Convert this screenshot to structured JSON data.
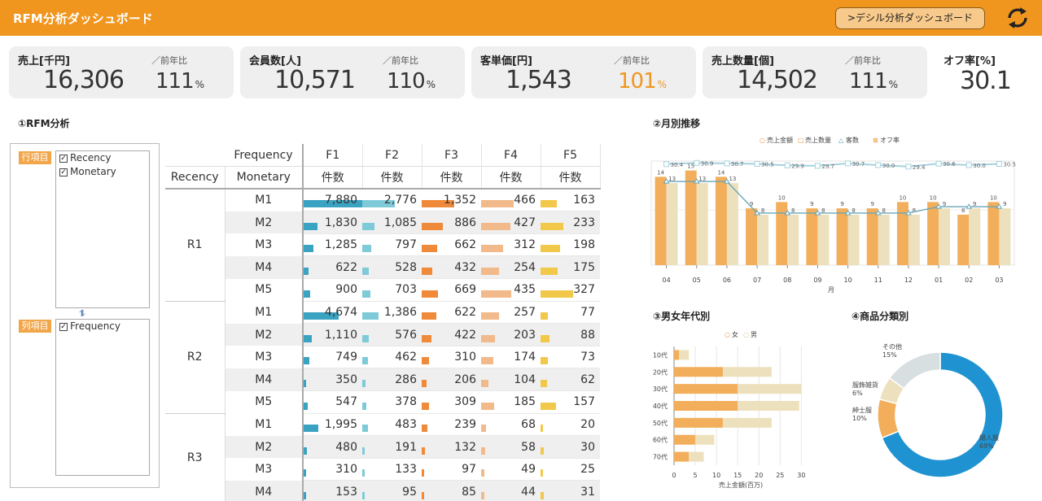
{
  "header": {
    "title": "RFM分析ダッシュボード",
    "button_label": ">デシル分析ダッシュボード",
    "refresh_icon": "refresh-icon",
    "color": "#f0961e"
  },
  "kpis": [
    {
      "label": "売上[千円]",
      "value": "16,306",
      "prev_label": "／前年比",
      "ratio": "111",
      "unit": "%",
      "ratio_color": "#333333"
    },
    {
      "label": "会員数[人]",
      "value": "10,571",
      "prev_label": "／前年比",
      "ratio": "110",
      "unit": "%",
      "ratio_color": "#333333"
    },
    {
      "label": "客単価[円]",
      "value": "1,543",
      "prev_label": "／前年比",
      "ratio": "101",
      "unit": "%",
      "ratio_color": "#f0961e"
    },
    {
      "label": "売上数量[個]",
      "value": "14,502",
      "prev_label": "／前年比",
      "ratio": "111",
      "unit": "%",
      "ratio_color": "#333333"
    },
    {
      "label": "オフ率[%]",
      "value": "30.1"
    }
  ],
  "rfm": {
    "title": "①RFM分析",
    "row_tag": "行項目",
    "col_tag": "列項目",
    "row_fields": [
      "Recency",
      "Monetary"
    ],
    "col_fields": [
      "Frequency"
    ],
    "swap_icon": "swap-icon",
    "header_row1": [
      "",
      "Frequency",
      "F1",
      "F2",
      "F3",
      "F4",
      "F5"
    ],
    "header_row2": [
      "Recency",
      "Monetary",
      "件数",
      "件数",
      "件数",
      "件数",
      "件数"
    ],
    "bar_colors": [
      "#3aa3c2",
      "#7fcad9",
      "#ef8a3a",
      "#f2b98a",
      "#f2c84a"
    ],
    "groups": [
      {
        "r": "R1",
        "rows": [
          {
            "m": "M1",
            "v": [
              7880,
              2776,
              1352,
              466,
              163
            ]
          },
          {
            "m": "M2",
            "v": [
              1830,
              1085,
              886,
              427,
              233
            ]
          },
          {
            "m": "M3",
            "v": [
              1285,
              797,
              662,
              312,
              198
            ]
          },
          {
            "m": "M4",
            "v": [
              622,
              528,
              432,
              254,
              175
            ]
          },
          {
            "m": "M5",
            "v": [
              900,
              703,
              669,
              435,
              327
            ]
          }
        ]
      },
      {
        "r": "R2",
        "rows": [
          {
            "m": "M1",
            "v": [
              4674,
              1386,
              622,
              257,
              77
            ]
          },
          {
            "m": "M2",
            "v": [
              1110,
              576,
              422,
              203,
              88
            ]
          },
          {
            "m": "M3",
            "v": [
              749,
              462,
              310,
              174,
              73
            ]
          },
          {
            "m": "M4",
            "v": [
              350,
              286,
              206,
              104,
              62
            ]
          },
          {
            "m": "M5",
            "v": [
              547,
              378,
              309,
              185,
              157
            ]
          }
        ]
      },
      {
        "r": "R3",
        "rows": [
          {
            "m": "M1",
            "v": [
              1995,
              483,
              239,
              68,
              20
            ]
          },
          {
            "m": "M2",
            "v": [
              480,
              191,
              132,
              58,
              30
            ]
          },
          {
            "m": "M3",
            "v": [
              310,
              133,
              97,
              49,
              25
            ]
          },
          {
            "m": "M4",
            "v": [
              153,
              95,
              85,
              44,
              31
            ]
          }
        ]
      }
    ]
  },
  "chart_data": [
    {
      "type": "bar",
      "title": "②月別推移",
      "xlabel": "月",
      "categories": [
        "04",
        "05",
        "06",
        "07",
        "08",
        "09",
        "10",
        "11",
        "12",
        "01",
        "02",
        "03"
      ],
      "series": [
        {
          "name": "売上金額",
          "kind": "bar",
          "color": "#f2ae5a",
          "values": [
            14,
            15,
            14,
            9,
            10,
            9,
            9,
            9,
            10,
            10,
            8,
            10
          ]
        },
        {
          "name": "売上数量",
          "kind": "bar",
          "color": "#ede0bc",
          "values": [
            13,
            13,
            13,
            8,
            8,
            8,
            8,
            8,
            8,
            9,
            9,
            9
          ]
        },
        {
          "name": "客数",
          "kind": "line",
          "color": "#6aa6b8",
          "values": [
            13,
            13,
            13,
            8,
            8,
            8,
            8,
            8,
            8,
            9,
            9,
            9
          ]
        },
        {
          "name": "オフ率",
          "kind": "line",
          "color": "#a6d2de",
          "values": [
            30.4,
            30.9,
            30.7,
            30.5,
            29.9,
            29.7,
            30.7,
            30.0,
            29.4,
            30.6,
            30.0,
            30.5
          ]
        }
      ]
    },
    {
      "type": "bar",
      "orientation": "horizontal",
      "stacked": true,
      "title": "③男女年代別",
      "xlabel": "売上金額(百万)",
      "categories": [
        "10代",
        "20代",
        "30代",
        "40代",
        "50代",
        "60代",
        "70代"
      ],
      "xlim": [
        0,
        30
      ],
      "xticks": [
        0,
        5,
        10,
        15,
        20,
        25,
        30
      ],
      "series": [
        {
          "name": "女",
          "color": "#f2ae5a",
          "values": [
            1.2,
            11.5,
            15,
            15,
            11.5,
            5,
            3.5
          ]
        },
        {
          "name": "男",
          "color": "#ede0bc",
          "values": [
            2.3,
            11.5,
            15,
            14.5,
            11.5,
            4.5,
            3.5
          ]
        }
      ]
    },
    {
      "type": "pie",
      "donut": true,
      "title": "④商品分類別",
      "slices": [
        {
          "label": "婦人服",
          "pct_label": "69%",
          "value": 69,
          "color": "#1f93d1"
        },
        {
          "label": "紳士服",
          "pct_label": "10%",
          "value": 10,
          "color": "#f2ae5a"
        },
        {
          "label": "服飾雑貨",
          "pct_label": "6%",
          "value": 6,
          "color": "#ede0bc"
        },
        {
          "label": "その他",
          "pct_label": "15%",
          "value": 15,
          "color": "#d8dfe1"
        }
      ]
    }
  ]
}
